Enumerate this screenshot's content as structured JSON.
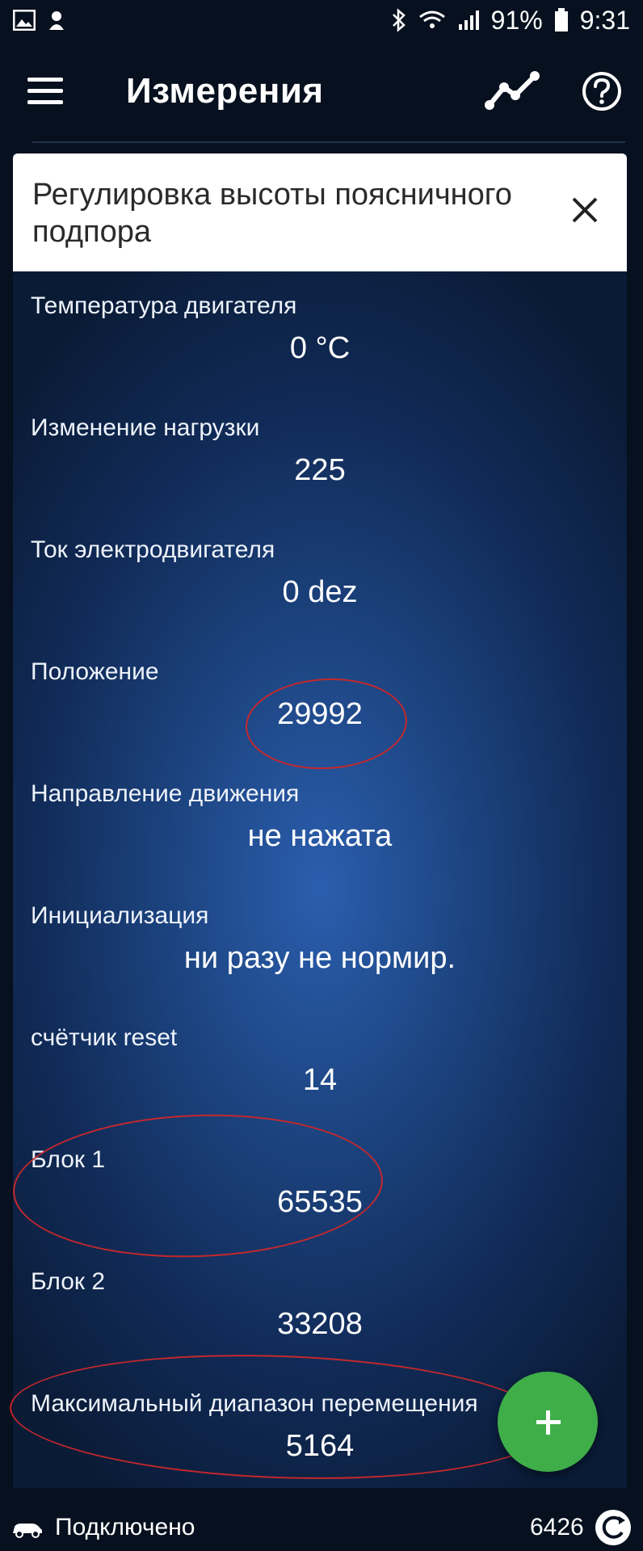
{
  "status_bar": {
    "battery": "91%",
    "time": "9:31"
  },
  "app_bar": {
    "title": "Измерения"
  },
  "banner": {
    "text": "Регулировка высоты поясничного подпора"
  },
  "measurements": [
    {
      "label": "Температура двигателя",
      "value": "0 °C"
    },
    {
      "label": "Изменение нагрузки",
      "value": "225"
    },
    {
      "label": "Ток электродвигателя",
      "value": "0 dez"
    },
    {
      "label": "Положение",
      "value": "29992"
    },
    {
      "label": "Направление движения",
      "value": "не нажата"
    },
    {
      "label": "Инициализация",
      "value": "ни разу не нормир."
    },
    {
      "label": "счётчик reset",
      "value": "14"
    },
    {
      "label": "Блок 1",
      "value": "65535"
    },
    {
      "label": "Блок 2",
      "value": "33208"
    },
    {
      "label": "Максимальный диапазон перемещения",
      "value": "5164"
    }
  ],
  "footer": {
    "status": "Подключено",
    "count": "6426"
  },
  "colors": {
    "fab": "#3fae49",
    "annotation": "#c4282c",
    "background": "#06101e"
  }
}
